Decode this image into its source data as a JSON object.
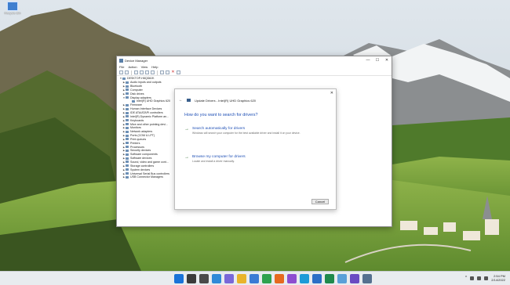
{
  "desktop": {
    "icon_label": "Recycle Bin"
  },
  "device_manager": {
    "title": "Device Manager",
    "window_controls": {
      "minimize": "—",
      "maximize": "☐",
      "close": "✕"
    },
    "menu": [
      "File",
      "Action",
      "View",
      "Help"
    ],
    "tree_root": "DESKTOP-H8QD8JK",
    "tree_items": [
      {
        "label": "Audio inputs and outputs",
        "level": 1,
        "expanded": false
      },
      {
        "label": "Bluetooth",
        "level": 1,
        "expanded": false
      },
      {
        "label": "Computer",
        "level": 1,
        "expanded": false
      },
      {
        "label": "Disk drives",
        "level": 1,
        "expanded": false
      },
      {
        "label": "Display adapters",
        "level": 1,
        "expanded": true
      },
      {
        "label": "Intel(R) UHD Graphics 620",
        "level": 2,
        "expanded": false
      },
      {
        "label": "Firmware",
        "level": 1,
        "expanded": false
      },
      {
        "label": "Human Interface Devices",
        "level": 1,
        "expanded": false
      },
      {
        "label": "IDE ATA/ATAPI controllers",
        "level": 1,
        "expanded": false
      },
      {
        "label": "Intel(R) Dynamic Platform an...",
        "level": 1,
        "expanded": false
      },
      {
        "label": "Keyboards",
        "level": 1,
        "expanded": false
      },
      {
        "label": "Mice and other pointing devi...",
        "level": 1,
        "expanded": false
      },
      {
        "label": "Monitors",
        "level": 1,
        "expanded": false
      },
      {
        "label": "Network adapters",
        "level": 1,
        "expanded": false
      },
      {
        "label": "Ports (COM & LPT)",
        "level": 1,
        "expanded": false
      },
      {
        "label": "Print queues",
        "level": 1,
        "expanded": false
      },
      {
        "label": "Printers",
        "level": 1,
        "expanded": false
      },
      {
        "label": "Processors",
        "level": 1,
        "expanded": false
      },
      {
        "label": "Security devices",
        "level": 1,
        "expanded": false
      },
      {
        "label": "Software components",
        "level": 1,
        "expanded": false
      },
      {
        "label": "Software devices",
        "level": 1,
        "expanded": false
      },
      {
        "label": "Sound, video and game cont...",
        "level": 1,
        "expanded": false
      },
      {
        "label": "Storage controllers",
        "level": 1,
        "expanded": false
      },
      {
        "label": "System devices",
        "level": 1,
        "expanded": false
      },
      {
        "label": "Universal Serial Bus controllers",
        "level": 1,
        "expanded": false
      },
      {
        "label": "USB Connector Managers",
        "level": 1,
        "expanded": false
      }
    ]
  },
  "dialog": {
    "close": "✕",
    "back": "←",
    "header": "Update Drivers - Intel(R) UHD Graphics 620",
    "question": "How do you want to search for drivers?",
    "option_auto": {
      "title": "Search automatically for drivers",
      "desc": "Windows will search your computer for the best available driver and install it on your device."
    },
    "option_browse": {
      "title": "Browse my computer for drivers",
      "desc": "Locate and install a driver manually."
    },
    "cancel": "Cancel"
  },
  "taskbar": {
    "time": "2:54 PM",
    "date": "2/14/2022",
    "tray_chevron": "^",
    "apps": [
      {
        "name": "start",
        "color": "#1a73d8"
      },
      {
        "name": "search",
        "color": "#3b3b3b"
      },
      {
        "name": "task-view",
        "color": "#4a4a4a"
      },
      {
        "name": "widgets",
        "color": "#2f8ad8"
      },
      {
        "name": "chat",
        "color": "#7a68d8"
      },
      {
        "name": "file-explorer",
        "color": "#e9b42a"
      },
      {
        "name": "microsoft-store",
        "color": "#3a7bd5"
      },
      {
        "name": "chrome",
        "color": "#2fa24f"
      },
      {
        "name": "firefox",
        "color": "#e66a1f"
      },
      {
        "name": "visual-studio",
        "color": "#8e4ed0"
      },
      {
        "name": "edge",
        "color": "#1c9bd8"
      },
      {
        "name": "outlook",
        "color": "#2b6fc6"
      },
      {
        "name": "excel",
        "color": "#1f8a4c"
      },
      {
        "name": "notepad",
        "color": "#5aa0d8"
      },
      {
        "name": "photos",
        "color": "#6a4bc2"
      },
      {
        "name": "device-manager",
        "color": "#55708f"
      }
    ]
  }
}
